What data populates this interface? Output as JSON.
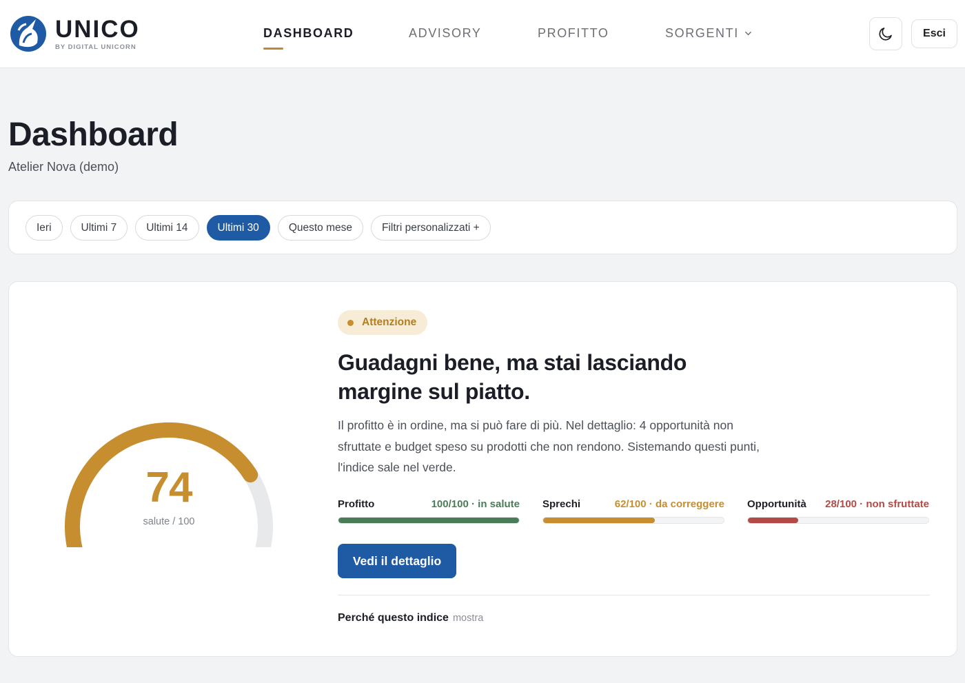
{
  "brand": {
    "name": "UNICO",
    "tagline": "BY DIGITAL UNICORN",
    "logo_icon": "unicorn-logo-icon",
    "accent_color": "#1f5ba5"
  },
  "nav": {
    "items": [
      {
        "label": "DASHBOARD",
        "active": true
      },
      {
        "label": "ADVISORY",
        "active": false
      },
      {
        "label": "PROFITTO",
        "active": false
      },
      {
        "label": "SORGENTI",
        "active": false,
        "has_dropdown": true
      }
    ]
  },
  "header_actions": {
    "theme_toggle_icon": "moon-icon",
    "logout_label": "Esci"
  },
  "page": {
    "title": "Dashboard",
    "subtitle": "Atelier Nova (demo)"
  },
  "filters": {
    "chips": [
      {
        "label": "Ieri",
        "active": false
      },
      {
        "label": "Ultimi 7",
        "active": false
      },
      {
        "label": "Ultimi 14",
        "active": false
      },
      {
        "label": "Ultimi 30",
        "active": true
      },
      {
        "label": "Questo mese",
        "active": false
      },
      {
        "label": "Filtri personalizzati +",
        "active": false
      }
    ]
  },
  "health": {
    "score": 74,
    "max": 100,
    "score_display": "74",
    "label": "salute / 100",
    "gauge_color": "#c68e2f",
    "track_color": "#e8e9eb",
    "status": {
      "label": "Attenzione",
      "color": "#c68e2f",
      "bg_color": "#f7ecd6"
    },
    "headline": "Guadagni bene, ma stai lasciando margine sul piatto.",
    "description": "Il profitto è in ordine, ma si può fare di più. Nel dettaglio: 4 opportunità non sfruttate e budget speso su prodotti che non rendono. Sistemando questi punti, l'indice sale nel verde.",
    "metrics": [
      {
        "label": "Profitto",
        "value_text": "100/100 · in salute",
        "score": 100,
        "color": "#4a7c59"
      },
      {
        "label": "Sprechi",
        "value_text": "62/100 · da correggere",
        "score": 62,
        "color": "#c68e2f"
      },
      {
        "label": "Opportunità",
        "value_text": "28/100 · non sfruttate",
        "score": 28,
        "color": "#b34a45"
      }
    ],
    "detail_button_label": "Vedi il dettaglio",
    "why": {
      "label": "Perché questo indice",
      "toggle_label": "mostra"
    }
  }
}
